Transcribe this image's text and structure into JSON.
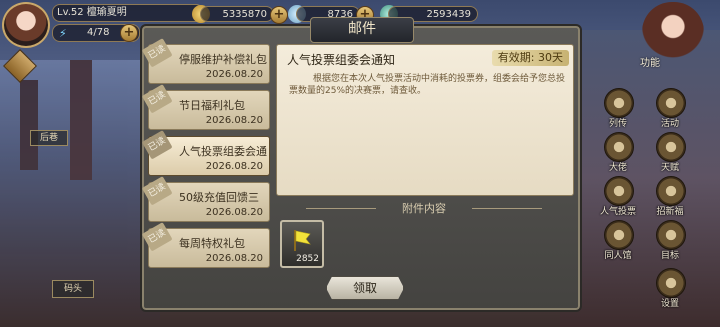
{
  "hud": {
    "level": "Lv.52 檀瑜夏明",
    "energy": "4/78",
    "resources": [
      "5335870",
      "8736",
      "2593439"
    ]
  },
  "mail": {
    "title": "邮件",
    "items": [
      {
        "tag": "已读",
        "title": "停服维护补偿礼包",
        "date": "2026.08.20"
      },
      {
        "tag": "已读",
        "title": "节日福利礼包",
        "date": "2026.08.20"
      },
      {
        "tag": "已读",
        "title": "人气投票组委会通",
        "date": "2026.08.20"
      },
      {
        "tag": "已读",
        "title": "50级充值回馈三",
        "date": "2026.08.20"
      },
      {
        "tag": "已读",
        "title": "每周特权礼包",
        "date": "2026.08.20"
      }
    ],
    "selected_index": 2,
    "content": {
      "title": "人气投票组委会通知",
      "validity": "有效期: 30天",
      "body": "根据您在本次人气投票活动中消耗的投票券，组委会给予您总投票数量的25%的决赛票，请查收。"
    },
    "attachments_label": "附件内容",
    "attachment": {
      "count": "2852",
      "icon": "yellow-flag-icon"
    },
    "claim_label": "领取"
  },
  "side_menu": {
    "function_label": "功能",
    "items": [
      "列传",
      "活动",
      "大佬",
      "天赋",
      "人气投票",
      "招新福",
      "同人馆",
      "目标",
      "设置"
    ]
  },
  "left_labels": {
    "label1": "后巷",
    "label2": "码头"
  }
}
